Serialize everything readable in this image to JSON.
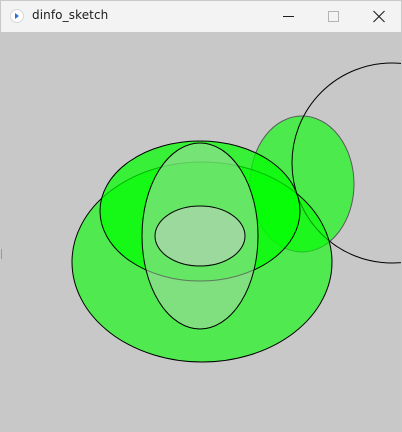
{
  "window": {
    "title": "dinfo_sketch"
  },
  "controls": {
    "minimize_icon": "minimize-icon",
    "maximize_icon": "maximize-icon",
    "close_icon": "close-icon"
  },
  "canvas": {
    "background": "#c8c8c8",
    "shapes": [
      {
        "name": "ellipse-right-green",
        "fill": "#00ff00",
        "opacity": 0.62,
        "stroke": "#555555"
      },
      {
        "name": "circle-right-outline",
        "fill": "none",
        "stroke": "#000000"
      },
      {
        "name": "ellipse-large-green",
        "fill": "#00ff00",
        "opacity": 0.62,
        "stroke": "#000000"
      },
      {
        "name": "ellipse-mid-green",
        "fill": "#00ff00",
        "opacity": 0.75,
        "stroke": "#000000"
      },
      {
        "name": "ellipse-tall-light",
        "fill": "#a0d8a0",
        "opacity": 0.55,
        "stroke": "#000000"
      },
      {
        "name": "ellipse-small-light",
        "fill": "#a0d8a0",
        "opacity": 0.95,
        "stroke": "#000000"
      }
    ]
  }
}
